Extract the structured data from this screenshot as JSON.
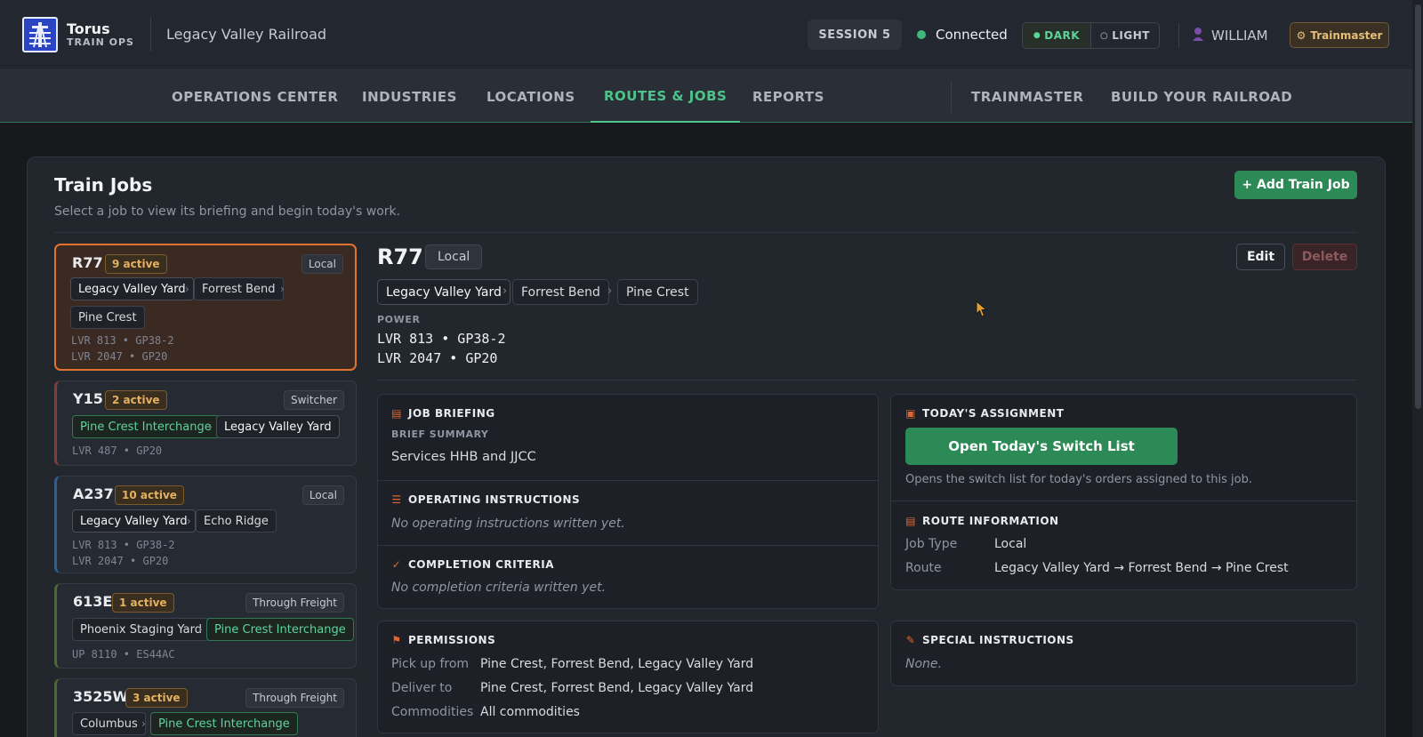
{
  "app": {
    "brand_name": "Torus",
    "brand_sub": "TRAIN OPS",
    "railroad_name": "Legacy Valley Railroad",
    "session": "SESSION 5",
    "connection": "Connected",
    "theme_dark": "DARK",
    "theme_light": "LIGHT",
    "user": "WILLIAM",
    "role_button": "Trainmaster"
  },
  "nav": {
    "tabs": [
      "OPERATIONS CENTER",
      "INDUSTRIES",
      "LOCATIONS",
      "ROUTES & JOBS",
      "REPORTS"
    ],
    "right_tabs": [
      "TRAINMASTER",
      "BUILD YOUR RAILROAD"
    ],
    "active": "ROUTES & JOBS"
  },
  "page": {
    "title": "Train Jobs",
    "subtitle": "Select a job to view its briefing and begin today's work.",
    "add_button": "+ Add Train Job"
  },
  "jobs": [
    {
      "id": "R77",
      "active": "9 active",
      "type": "Local",
      "stops": [
        "Legacy Valley Yard",
        "Forrest Bend",
        "Pine Crest"
      ],
      "power": [
        "LVR 813 • GP38-2",
        "LVR 2047 • GP20"
      ],
      "accent": "#e07330"
    },
    {
      "id": "Y15",
      "active": "2 active",
      "type": "Switcher",
      "stops": [
        "Pine Crest Interchange",
        "Legacy Valley Yard"
      ],
      "power": [
        "LVR 487 • GP20"
      ],
      "accent": "#8a3a3a"
    },
    {
      "id": "A237",
      "active": "10 active",
      "type": "Local",
      "stops": [
        "Legacy Valley Yard",
        "Echo Ridge"
      ],
      "power": [
        "LVR 813 • GP38-2",
        "LVR 2047 • GP20"
      ],
      "accent": "#2f5f9a"
    },
    {
      "id": "613E",
      "active": "1 active",
      "type": "Through Freight",
      "stops": [
        "Phoenix Staging Yard",
        "Pine Crest Interchange"
      ],
      "power": [
        "UP 8110 • ES44AC"
      ],
      "accent": "#4a6a2f"
    },
    {
      "id": "3525W",
      "active": "3 active",
      "type": "Through Freight",
      "stops": [
        "Columbus",
        "Pine Crest Interchange"
      ],
      "power": [],
      "accent": "#4a6a2f"
    }
  ],
  "detail": {
    "id": "R77",
    "type": "Local",
    "edit": "Edit",
    "delete": "Delete",
    "route": [
      "Legacy Valley Yard",
      "Forrest Bend",
      "Pine Crest"
    ],
    "power_label": "POWER",
    "power": [
      "LVR 813 • GP38-2",
      "LVR 2047 • GP20"
    ],
    "briefing_title": "JOB BRIEFING",
    "brief_summary_label": "BRIEF SUMMARY",
    "brief_summary": "Services HHB and JJCC",
    "operating_title": "OPERATING INSTRUCTIONS",
    "operating_text": "No operating instructions written yet.",
    "completion_title": "COMPLETION CRITERIA",
    "completion_text": "No completion criteria written yet.",
    "assignment_title": "TODAY'S ASSIGNMENT",
    "switch_list_button": "Open Today's Switch List",
    "switch_list_note": "Opens the switch list for today's orders assigned to this job.",
    "route_info_title": "ROUTE INFORMATION",
    "job_type_label": "Job Type",
    "job_type_value": "Local",
    "route_label": "Route",
    "route_value": "Legacy Valley Yard → Forrest Bend → Pine Crest",
    "permissions_title": "PERMISSIONS",
    "pickup_label": "Pick up from",
    "pickup_value": "Pine Crest, Forrest Bend, Legacy Valley Yard",
    "deliver_label": "Deliver to",
    "deliver_value": "Pine Crest, Forrest Bend, Legacy Valley Yard",
    "commodities_label": "Commodities",
    "commodities_value": "All commodities",
    "special_title": "SPECIAL INSTRUCTIONS",
    "special_text": "None."
  },
  "colors": {
    "accent_green": "#4dc48a",
    "button_green": "#2b8a55",
    "selected_orange": "#e07330",
    "badge_amber": "#e4b061"
  }
}
